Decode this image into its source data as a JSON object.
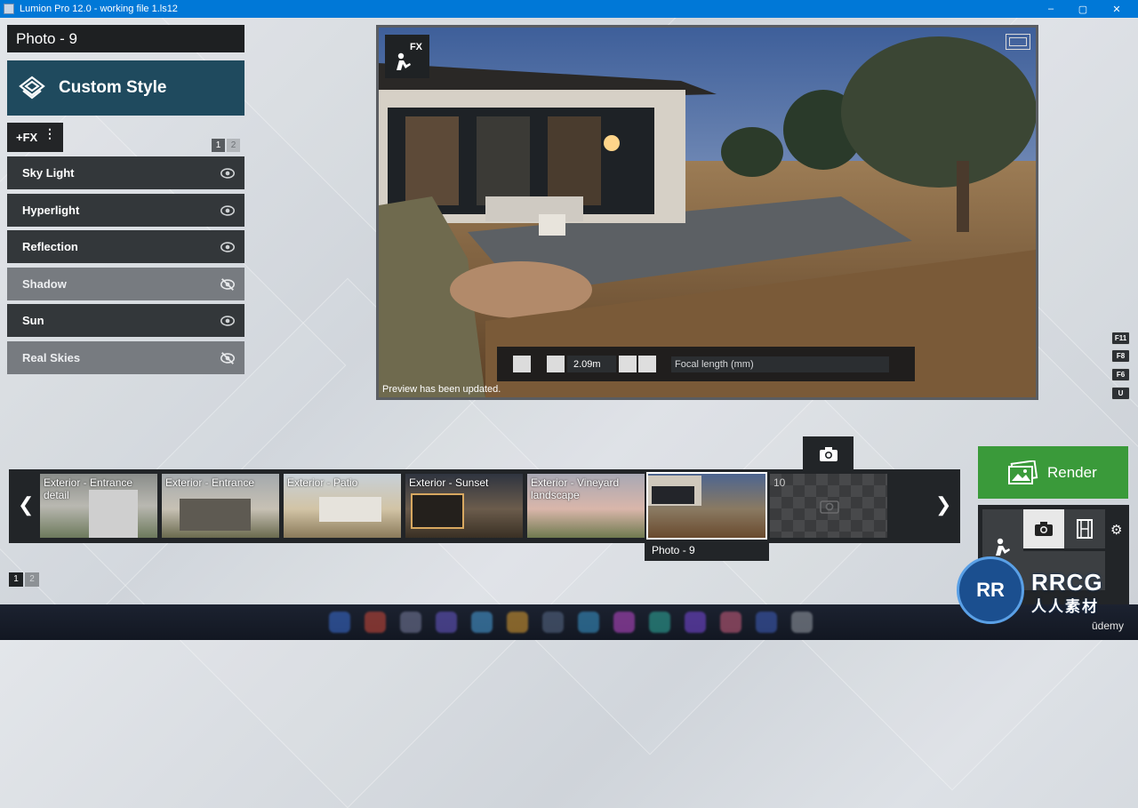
{
  "window": {
    "title": "Lumion Pro 12.0 - working file 1.ls12",
    "minimize_glyph": "–",
    "maximize_glyph": "▢",
    "close_glyph": "✕"
  },
  "left_panel": {
    "photo_title": "Photo - 9",
    "style_button": {
      "label": "Custom Style",
      "icon": "layers-icon"
    },
    "fx_button": {
      "label": "+FX",
      "menu_glyph": "⋮"
    },
    "effect_pages": [
      "1",
      "2"
    ],
    "effects": [
      {
        "label": "Sky Light",
        "visible": true
      },
      {
        "label": "Hyperlight",
        "visible": true
      },
      {
        "label": "Reflection",
        "visible": true
      },
      {
        "label": "Shadow",
        "visible": false
      },
      {
        "label": "Sun",
        "visible": true
      },
      {
        "label": "Real Skies",
        "visible": false
      }
    ]
  },
  "viewport": {
    "fx_badge": "FX",
    "camera_height": "2.09m",
    "focal_length_label": "Focal length (mm)",
    "status": "Preview has been updated.",
    "shortcut_keys": [
      "F11",
      "F8",
      "F6",
      "U"
    ]
  },
  "filmstrip": {
    "thumbnails": [
      {
        "caption": "Exterior - Entrance detail"
      },
      {
        "caption": "Exterior - Entrance"
      },
      {
        "caption": "Exterior - Patio"
      },
      {
        "caption": "Exterior - Sunset"
      },
      {
        "caption": "Exterior - Vineyard landscape"
      },
      {
        "caption": ""
      }
    ],
    "selected_label": "Photo - 9",
    "empty_slot_number": "10",
    "pages": [
      "1",
      "2"
    ]
  },
  "render": {
    "label": "Render"
  },
  "modes": [
    "fx-worker-icon",
    "camera-icon",
    "film-icon",
    "settings-icon"
  ],
  "watermark": {
    "badge": "RR",
    "line1": "RRCG",
    "line2": "人人素材",
    "udemy": "ūdemy"
  },
  "colors": {
    "render_green": "#3a9a3a",
    "style_teal": "#1f4a5e",
    "titlebar_blue": "#0078d7"
  }
}
